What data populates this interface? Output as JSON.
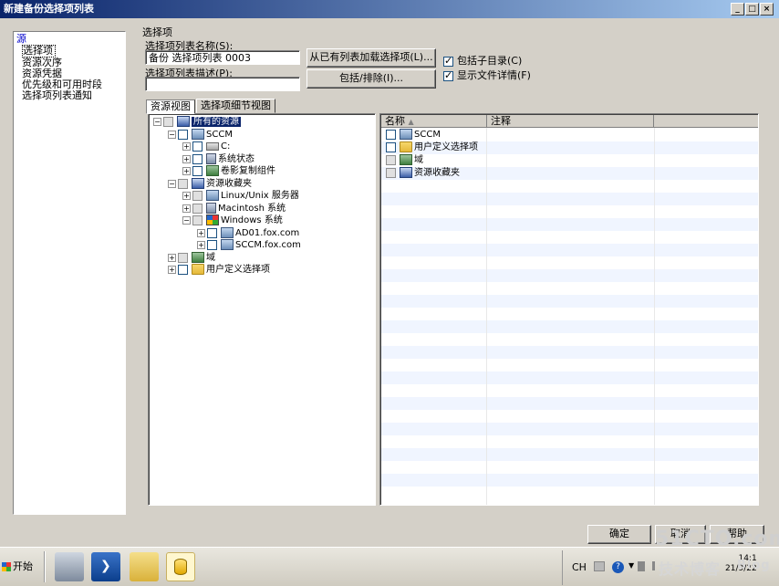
{
  "window": {
    "title": "新建备份选择项列表",
    "controls": [
      "_",
      "□",
      "×"
    ]
  },
  "nav": {
    "root": "源",
    "items": [
      "选择项",
      "资源次序",
      "资源凭据",
      "优先级和可用时段",
      "选择项列表通知"
    ]
  },
  "options": {
    "group_label": "选择项",
    "name_label": "选择项列表名称(S):",
    "name_value": "备份 选择项列表 0003",
    "desc_label": "选择项列表描述(P):",
    "desc_value": "",
    "load_button": "从已有列表加载选择项(L)...",
    "include_button": "包括/排除(I)...",
    "include_subdirs": "包括子目录(C)",
    "show_file_details": "显示文件详情(F)"
  },
  "tabs": [
    "资源视图",
    "选择项细节视图"
  ],
  "tree": [
    {
      "label": "所有的资源",
      "level": 0,
      "pm": "−",
      "icon": "res-icon",
      "selected": true
    },
    {
      "label": "SCCM",
      "level": 1,
      "pm": "−",
      "icon": "pc-icon"
    },
    {
      "label": "C:",
      "level": 2,
      "pm": "+",
      "icon": "drive-icon"
    },
    {
      "label": "系统状态",
      "level": 2,
      "pm": "+",
      "icon": "server-icon"
    },
    {
      "label": "卷影复制组件",
      "level": 2,
      "pm": "+",
      "icon": "net-icon"
    },
    {
      "label": "资源收藏夹",
      "level": 1,
      "pm": "−",
      "icon": "res-icon"
    },
    {
      "label": "Linux/Unix 服务器",
      "level": 2,
      "pm": "+",
      "icon": "pc-icon"
    },
    {
      "label": "Macintosh 系统",
      "level": 2,
      "pm": "+",
      "icon": "server-icon"
    },
    {
      "label": "Windows 系统",
      "level": 2,
      "pm": "−",
      "icon": "win-icon"
    },
    {
      "label": "AD01.fox.com",
      "level": 3,
      "pm": "+",
      "icon": "pc-icon"
    },
    {
      "label": "SCCM.fox.com",
      "level": 3,
      "pm": "+",
      "icon": "pc-icon"
    },
    {
      "label": "域",
      "level": 1,
      "pm": "+",
      "icon": "net-icon"
    },
    {
      "label": "用户定义选择项",
      "level": 1,
      "pm": "+",
      "icon": "folder-icon"
    }
  ],
  "list": {
    "columns": [
      "名称",
      "注释"
    ],
    "rows": [
      {
        "name": "SCCM",
        "icon": "pc-icon"
      },
      {
        "name": "用户定义选择项",
        "icon": "folder-icon"
      },
      {
        "name": "域",
        "icon": "net-icon"
      },
      {
        "name": "资源收藏夹",
        "icon": "res-icon"
      }
    ]
  },
  "footer": {
    "ok": "确定",
    "cancel": "取消",
    "help": "帮助"
  },
  "taskbar": {
    "start": "开始",
    "lang": "CH",
    "time": "14:1",
    "date": "21/9/22"
  },
  "watermark": {
    "brand": "51CTO.com",
    "sub": "技术博客",
    "blog": "Blog"
  }
}
